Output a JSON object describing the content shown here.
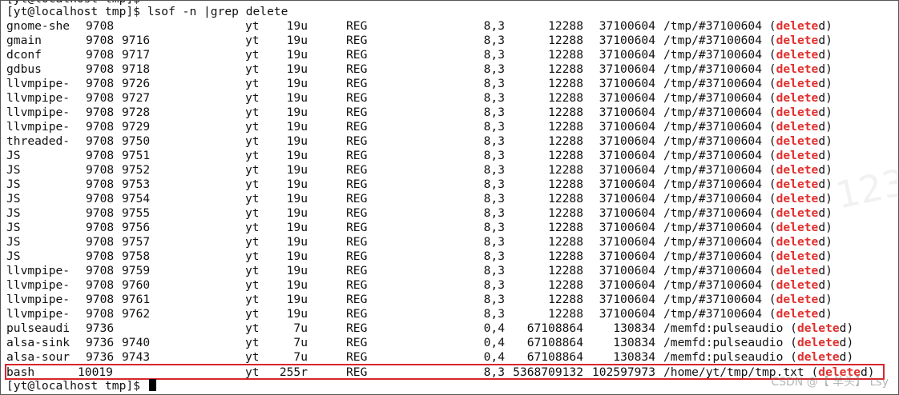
{
  "terminal": {
    "top_partial_text": "[yt@localhost tmp]$",
    "command_prompt": "[yt@localhost tmp]$ lsof -n |grep delete",
    "final_prompt": "[yt@localhost tmp]$ "
  },
  "rows": [
    {
      "cmd": "gnome-she",
      "pid": "9708",
      "tid": "",
      "user": "yt",
      "fd": "19u",
      "type": "REG",
      "dev": "8,3",
      "size": "12288",
      "node": "37100604",
      "name": "/tmp/#37100604 (",
      "del": "delete",
      "suffix": "d)"
    },
    {
      "cmd": "gmain",
      "pid": "9708",
      "tid": "9716",
      "user": "yt",
      "fd": "19u",
      "type": "REG",
      "dev": "8,3",
      "size": "12288",
      "node": "37100604",
      "name": "/tmp/#37100604 (",
      "del": "delete",
      "suffix": "d)"
    },
    {
      "cmd": "dconf",
      "pid": "9708",
      "tid": "9717",
      "user": "yt",
      "fd": "19u",
      "type": "REG",
      "dev": "8,3",
      "size": "12288",
      "node": "37100604",
      "name": "/tmp/#37100604 (",
      "del": "delete",
      "suffix": "d)"
    },
    {
      "cmd": "gdbus",
      "pid": "9708",
      "tid": "9718",
      "user": "yt",
      "fd": "19u",
      "type": "REG",
      "dev": "8,3",
      "size": "12288",
      "node": "37100604",
      "name": "/tmp/#37100604 (",
      "del": "delete",
      "suffix": "d)"
    },
    {
      "cmd": "llvmpipe-",
      "pid": "9708",
      "tid": "9726",
      "user": "yt",
      "fd": "19u",
      "type": "REG",
      "dev": "8,3",
      "size": "12288",
      "node": "37100604",
      "name": "/tmp/#37100604 (",
      "del": "delete",
      "suffix": "d)"
    },
    {
      "cmd": "llvmpipe-",
      "pid": "9708",
      "tid": "9727",
      "user": "yt",
      "fd": "19u",
      "type": "REG",
      "dev": "8,3",
      "size": "12288",
      "node": "37100604",
      "name": "/tmp/#37100604 (",
      "del": "delete",
      "suffix": "d)"
    },
    {
      "cmd": "llvmpipe-",
      "pid": "9708",
      "tid": "9728",
      "user": "yt",
      "fd": "19u",
      "type": "REG",
      "dev": "8,3",
      "size": "12288",
      "node": "37100604",
      "name": "/tmp/#37100604 (",
      "del": "delete",
      "suffix": "d)"
    },
    {
      "cmd": "llvmpipe-",
      "pid": "9708",
      "tid": "9729",
      "user": "yt",
      "fd": "19u",
      "type": "REG",
      "dev": "8,3",
      "size": "12288",
      "node": "37100604",
      "name": "/tmp/#37100604 (",
      "del": "delete",
      "suffix": "d)"
    },
    {
      "cmd": "threaded-",
      "pid": "9708",
      "tid": "9750",
      "user": "yt",
      "fd": "19u",
      "type": "REG",
      "dev": "8,3",
      "size": "12288",
      "node": "37100604",
      "name": "/tmp/#37100604 (",
      "del": "delete",
      "suffix": "d)"
    },
    {
      "cmd": "JS",
      "pid": "9708",
      "tid": "9751",
      "user": "yt",
      "fd": "19u",
      "type": "REG",
      "dev": "8,3",
      "size": "12288",
      "node": "37100604",
      "name": "/tmp/#37100604 (",
      "del": "delete",
      "suffix": "d)"
    },
    {
      "cmd": "JS",
      "pid": "9708",
      "tid": "9752",
      "user": "yt",
      "fd": "19u",
      "type": "REG",
      "dev": "8,3",
      "size": "12288",
      "node": "37100604",
      "name": "/tmp/#37100604 (",
      "del": "delete",
      "suffix": "d)"
    },
    {
      "cmd": "JS",
      "pid": "9708",
      "tid": "9753",
      "user": "yt",
      "fd": "19u",
      "type": "REG",
      "dev": "8,3",
      "size": "12288",
      "node": "37100604",
      "name": "/tmp/#37100604 (",
      "del": "delete",
      "suffix": "d)"
    },
    {
      "cmd": "JS",
      "pid": "9708",
      "tid": "9754",
      "user": "yt",
      "fd": "19u",
      "type": "REG",
      "dev": "8,3",
      "size": "12288",
      "node": "37100604",
      "name": "/tmp/#37100604 (",
      "del": "delete",
      "suffix": "d)"
    },
    {
      "cmd": "JS",
      "pid": "9708",
      "tid": "9755",
      "user": "yt",
      "fd": "19u",
      "type": "REG",
      "dev": "8,3",
      "size": "12288",
      "node": "37100604",
      "name": "/tmp/#37100604 (",
      "del": "delete",
      "suffix": "d)"
    },
    {
      "cmd": "JS",
      "pid": "9708",
      "tid": "9756",
      "user": "yt",
      "fd": "19u",
      "type": "REG",
      "dev": "8,3",
      "size": "12288",
      "node": "37100604",
      "name": "/tmp/#37100604 (",
      "del": "delete",
      "suffix": "d)"
    },
    {
      "cmd": "JS",
      "pid": "9708",
      "tid": "9757",
      "user": "yt",
      "fd": "19u",
      "type": "REG",
      "dev": "8,3",
      "size": "12288",
      "node": "37100604",
      "name": "/tmp/#37100604 (",
      "del": "delete",
      "suffix": "d)"
    },
    {
      "cmd": "JS",
      "pid": "9708",
      "tid": "9758",
      "user": "yt",
      "fd": "19u",
      "type": "REG",
      "dev": "8,3",
      "size": "12288",
      "node": "37100604",
      "name": "/tmp/#37100604 (",
      "del": "delete",
      "suffix": "d)"
    },
    {
      "cmd": "llvmpipe-",
      "pid": "9708",
      "tid": "9759",
      "user": "yt",
      "fd": "19u",
      "type": "REG",
      "dev": "8,3",
      "size": "12288",
      "node": "37100604",
      "name": "/tmp/#37100604 (",
      "del": "delete",
      "suffix": "d)"
    },
    {
      "cmd": "llvmpipe-",
      "pid": "9708",
      "tid": "9760",
      "user": "yt",
      "fd": "19u",
      "type": "REG",
      "dev": "8,3",
      "size": "12288",
      "node": "37100604",
      "name": "/tmp/#37100604 (",
      "del": "delete",
      "suffix": "d)"
    },
    {
      "cmd": "llvmpipe-",
      "pid": "9708",
      "tid": "9761",
      "user": "yt",
      "fd": "19u",
      "type": "REG",
      "dev": "8,3",
      "size": "12288",
      "node": "37100604",
      "name": "/tmp/#37100604 (",
      "del": "delete",
      "suffix": "d)"
    },
    {
      "cmd": "llvmpipe-",
      "pid": "9708",
      "tid": "9762",
      "user": "yt",
      "fd": "19u",
      "type": "REG",
      "dev": "8,3",
      "size": "12288",
      "node": "37100604",
      "name": "/tmp/#37100604 (",
      "del": "delete",
      "suffix": "d)"
    },
    {
      "cmd": "pulseaudi",
      "pid": "9736",
      "tid": "",
      "user": "yt",
      "fd": "7u",
      "type": "REG",
      "dev": "0,4",
      "size": "67108864",
      "node": "130834",
      "name": "/memfd:pulseaudio (",
      "del": "delete",
      "suffix": "d)"
    },
    {
      "cmd": "alsa-sink",
      "pid": "9736",
      "tid": "9740",
      "user": "yt",
      "fd": "7u",
      "type": "REG",
      "dev": "0,4",
      "size": "67108864",
      "node": "130834",
      "name": "/memfd:pulseaudio (",
      "del": "delete",
      "suffix": "d)"
    },
    {
      "cmd": "alsa-sour",
      "pid": "9736",
      "tid": "9743",
      "user": "yt",
      "fd": "7u",
      "type": "REG",
      "dev": "0,4",
      "size": "67108864",
      "node": "130834",
      "name": "/memfd:pulseaudio (",
      "del": "delete",
      "suffix": "d)"
    }
  ],
  "bash_row": {
    "cmd": "bash",
    "pid": "10019",
    "user": "yt",
    "fd": "255r",
    "type": "REG",
    "dev": "8,3",
    "size": "5368709132",
    "node": "102597973",
    "name": "/home/yt/tmp/tmp.txt (",
    "del": "delete",
    "suffix": "d)"
  },
  "watermark": "CSDN @【 羊头】 Lsy",
  "watermark_bg": "123",
  "colors": {
    "deleted": "#e0302e",
    "highlight_border": "#d8262b"
  }
}
